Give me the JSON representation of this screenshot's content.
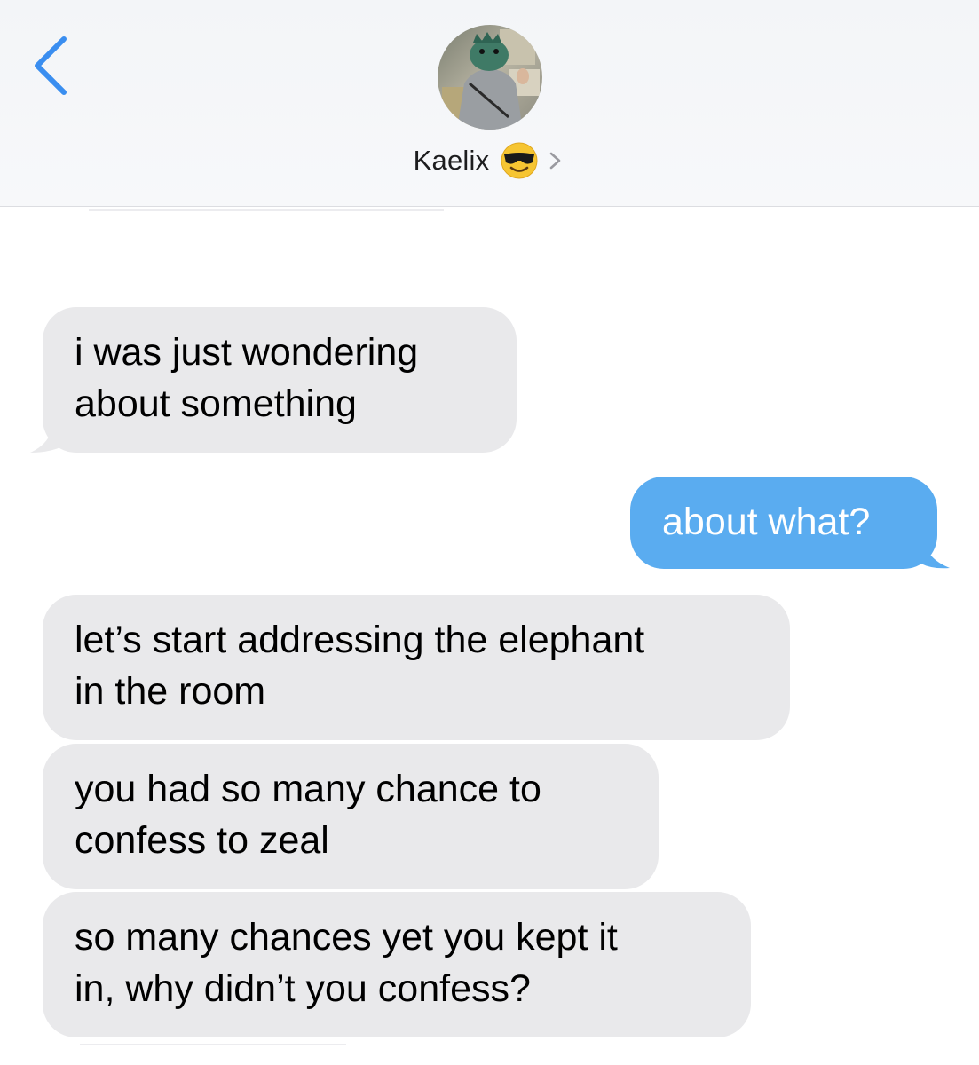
{
  "header": {
    "contact_name": "Kaelix",
    "emoji_icon": "smiling-face-with-sunglasses-icon",
    "chevron_icon": "chevron-right-icon",
    "back_icon": "chevron-left-icon"
  },
  "messages": [
    {
      "direction": "received",
      "lines": [
        "i was just wondering",
        "about something"
      ]
    },
    {
      "direction": "sent",
      "lines": [
        "about what?"
      ]
    },
    {
      "direction": "received",
      "lines": [
        "let’s start addressing the elephant",
        "in the room"
      ]
    },
    {
      "direction": "received",
      "lines": [
        "you had so many chance to",
        "confess to zeal"
      ]
    },
    {
      "direction": "received",
      "lines": [
        "so many chances yet you kept it",
        "in, why didn’t you confess?"
      ]
    }
  ],
  "colors": {
    "accent": "#3a8ef0",
    "sent_bubble": "#5aacf0",
    "received_bubble": "#e9e9eb",
    "header_bg": "#f4f6f8"
  }
}
